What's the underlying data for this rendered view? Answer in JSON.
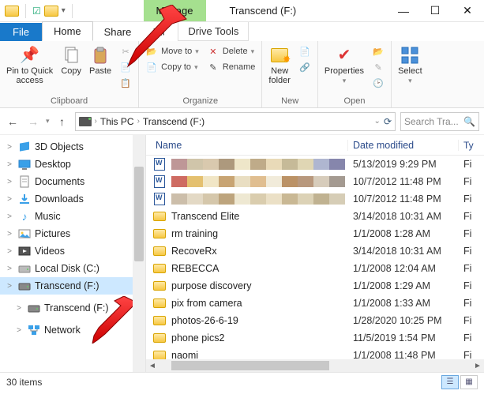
{
  "window": {
    "title": "Transcend (F:)",
    "context_tab": "Manage"
  },
  "tabs": {
    "file": "File",
    "home": "Home",
    "share": "Share",
    "view": "View",
    "drivetools": "Drive Tools"
  },
  "ribbon": {
    "pin": "Pin to Quick\naccess",
    "copy": "Copy",
    "paste": "Paste",
    "clipboard_label": "Clipboard",
    "moveto": "Move to",
    "copyto": "Copy to",
    "delete": "Delete",
    "rename": "Rename",
    "organize_label": "Organize",
    "newfolder": "New\nfolder",
    "new_label": "New",
    "properties": "Properties",
    "open_label": "Open",
    "select": "Select"
  },
  "addr": {
    "pc": "This PC",
    "loc": "Transcend (F:)",
    "search_placeholder": "Search Tra..."
  },
  "tree": [
    {
      "id": "3d",
      "label": "3D Objects",
      "exp": ">"
    },
    {
      "id": "desktop",
      "label": "Desktop",
      "exp": ">"
    },
    {
      "id": "documents",
      "label": "Documents",
      "exp": ">"
    },
    {
      "id": "downloads",
      "label": "Downloads",
      "exp": ">"
    },
    {
      "id": "music",
      "label": "Music",
      "exp": ">"
    },
    {
      "id": "pictures",
      "label": "Pictures",
      "exp": ">"
    },
    {
      "id": "videos",
      "label": "Videos",
      "exp": ">"
    },
    {
      "id": "localc",
      "label": "Local Disk (C:)",
      "exp": ">"
    },
    {
      "id": "transcendf",
      "label": "Transcend (F:)",
      "exp": ">",
      "selected": true
    },
    {
      "id": "transcendf2",
      "label": "Transcend (F:)",
      "exp": ">",
      "sub": true
    },
    {
      "id": "network",
      "label": "Network",
      "exp": ">",
      "sub": true
    }
  ],
  "columns": {
    "name": "Name",
    "date": "Date modified",
    "type": "Ty"
  },
  "files": [
    {
      "kind": "word",
      "blurred": true,
      "date": "5/13/2019 9:29 PM",
      "type": "Fi"
    },
    {
      "kind": "word",
      "blurred": true,
      "date": "10/7/2012 11:48 PM",
      "type": "Fi"
    },
    {
      "kind": "word",
      "blurred": true,
      "date": "10/7/2012 11:48 PM",
      "type": "Fi"
    },
    {
      "kind": "folder",
      "name": "Transcend Elite",
      "date": "3/14/2018 10:31 AM",
      "type": "Fi"
    },
    {
      "kind": "folder",
      "name": "rm training",
      "date": "1/1/2008 1:28 AM",
      "type": "Fi"
    },
    {
      "kind": "folder",
      "name": "RecoveRx",
      "date": "3/14/2018 10:31 AM",
      "type": "Fi"
    },
    {
      "kind": "folder",
      "name": "REBECCA",
      "date": "1/1/2008 12:04 AM",
      "type": "Fi"
    },
    {
      "kind": "folder",
      "name": "purpose discovery",
      "date": "1/1/2008 1:29 AM",
      "type": "Fi"
    },
    {
      "kind": "folder",
      "name": "pix from camera",
      "date": "1/1/2008 1:33 AM",
      "type": "Fi"
    },
    {
      "kind": "folder",
      "name": "photos-26-6-19",
      "date": "1/28/2020 10:25 PM",
      "type": "Fi"
    },
    {
      "kind": "folder",
      "name": "phone pics2",
      "date": "11/5/2019 1:54 PM",
      "type": "Fi"
    },
    {
      "kind": "folder",
      "name": "naomi",
      "date": "1/1/2008 11:48 PM",
      "type": "Fi"
    }
  ],
  "status": {
    "count": "30 items"
  },
  "blur_colors": [
    [
      "#b78b8b",
      "#cbbfa0",
      "#d5c3a5",
      "#a48e6f",
      "#ece3c3",
      "#b8a27c",
      "#e7d6b0",
      "#c0b28d",
      "#ddd1ac",
      "#a6aecb",
      "#7879a3"
    ],
    [
      "#c95b50",
      "#e1b95f",
      "#efe3c0",
      "#c29a63",
      "#e7dabb",
      "#ddb784",
      "#efe9d6",
      "#b38655",
      "#b08c6f",
      "#d3c6b3",
      "#9a8f85"
    ],
    [
      "#c6b7a0",
      "#e0d5be",
      "#d0c1a2",
      "#b69a6e",
      "#ece5cd",
      "#d6c7a5",
      "#e9dcc0",
      "#c3b088",
      "#d8cdae",
      "#b9a985",
      "#d1c7ae"
    ]
  ]
}
